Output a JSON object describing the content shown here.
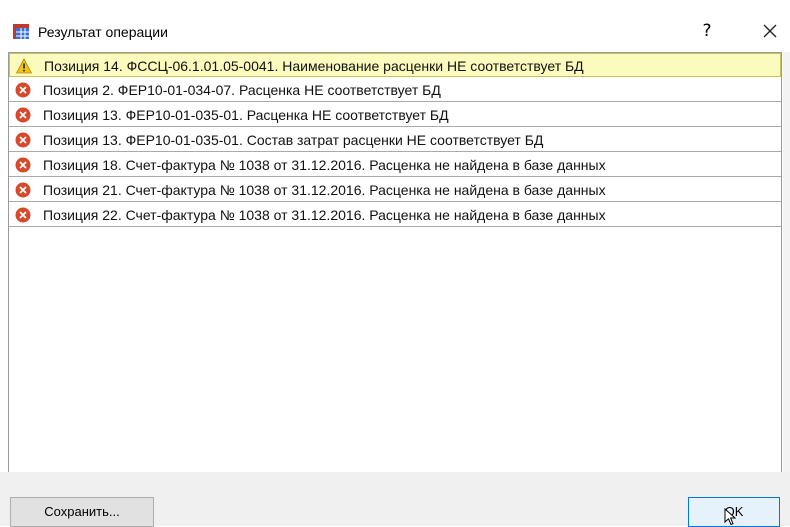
{
  "window": {
    "title": "Результат операции",
    "title_icon": "table-grid-icon",
    "help_label": "?",
    "close_icon": "close-icon"
  },
  "messages": [
    {
      "type": "warning",
      "icon": "warning-icon",
      "text": "Позиция 14. ФССЦ-06.1.01.05-0041. Наименование расценки НЕ соответствует БД"
    },
    {
      "type": "error",
      "icon": "error-icon",
      "text": "Позиция 2. ФЕР10-01-034-07. Расценка НЕ соответствует БД"
    },
    {
      "type": "error",
      "icon": "error-icon",
      "text": "Позиция 13. ФЕР10-01-035-01. Расценка НЕ соответствует БД"
    },
    {
      "type": "error",
      "icon": "error-icon",
      "text": "Позиция 13. ФЕР10-01-035-01. Состав затрат расценки НЕ соответствует БД"
    },
    {
      "type": "error",
      "icon": "error-icon",
      "text": "Позиция 18. Счет-фактура № 1038 от 31.12.2016. Расценка не найдена в базе данных"
    },
    {
      "type": "error",
      "icon": "error-icon",
      "text": "Позиция 21. Счет-фактура № 1038 от 31.12.2016. Расценка не найдена в базе данных"
    },
    {
      "type": "error",
      "icon": "error-icon",
      "text": "Позиция 22. Счет-фактура № 1038 от 31.12.2016. Расценка не найдена в базе данных"
    }
  ],
  "footer": {
    "save_label": "Сохранить...",
    "ok_label": "OK"
  },
  "colors": {
    "warning_row_bg": "#fbfbbd",
    "error_icon": "#d6492b",
    "warning_icon": "#f2c21b",
    "ok_border": "#0078d7"
  }
}
